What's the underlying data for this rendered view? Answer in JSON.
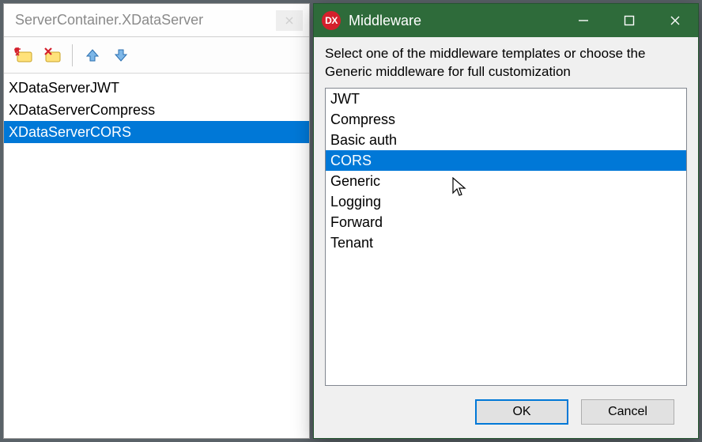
{
  "editor": {
    "title": "ServerContainer.XDataServer",
    "items": [
      {
        "label": "XDataServerJWT",
        "selected": false
      },
      {
        "label": "XDataServerCompress",
        "selected": false
      },
      {
        "label": "XDataServerCORS",
        "selected": true
      }
    ]
  },
  "dialog": {
    "app_badge": "DX",
    "title": "Middleware",
    "instruction": "Select one of the middleware templates or choose the Generic middleware for full customization",
    "items": [
      {
        "label": "JWT",
        "selected": false
      },
      {
        "label": "Compress",
        "selected": false
      },
      {
        "label": "Basic auth",
        "selected": false
      },
      {
        "label": "CORS",
        "selected": true
      },
      {
        "label": "Generic",
        "selected": false
      },
      {
        "label": "Logging",
        "selected": false
      },
      {
        "label": "Forward",
        "selected": false
      },
      {
        "label": "Tenant",
        "selected": false
      }
    ],
    "ok_label": "OK",
    "cancel_label": "Cancel"
  },
  "colors": {
    "selection": "#0078d7",
    "dialog_chrome": "#2e6b3a",
    "badge": "#d4202c"
  }
}
